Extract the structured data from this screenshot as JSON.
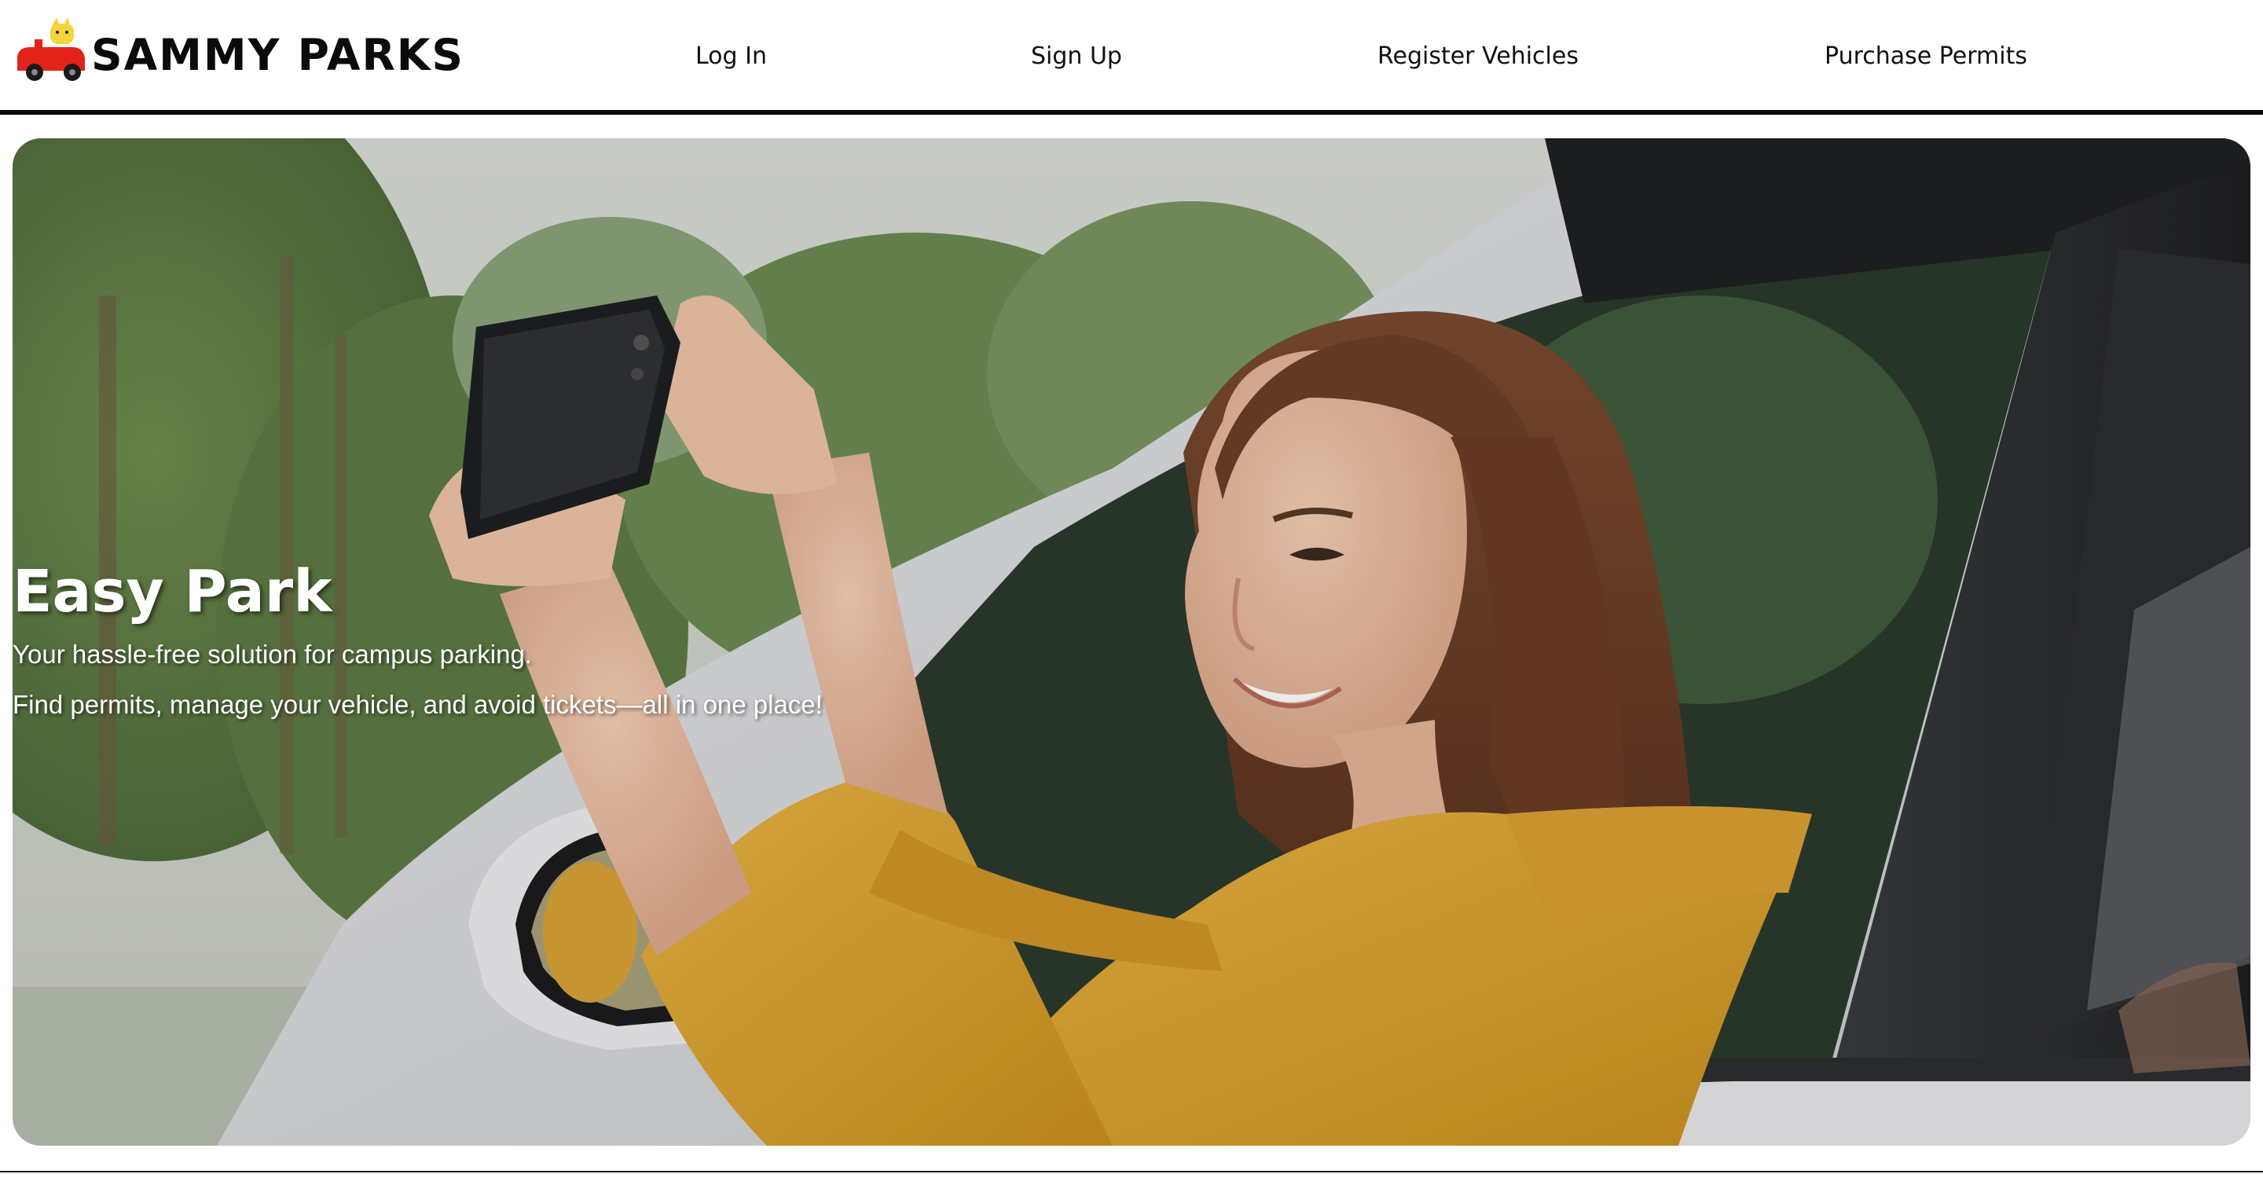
{
  "brand": {
    "name": "SAMMY PARKS",
    "logo_icon": "red-car-with-cat-icon"
  },
  "nav": [
    {
      "label": "Log In"
    },
    {
      "label": "Sign Up"
    },
    {
      "label": "Register Vehicles"
    },
    {
      "label": "Purchase Permits"
    }
  ],
  "hero": {
    "title": "Easy Park",
    "line1": "Your hassle-free solution for campus parking.",
    "line2": "Find permits, manage your vehicle, and avoid tickets—all in one place!",
    "image": "woman-in-yellow-sweater-photographing-from-car-window"
  },
  "colors": {
    "header_border": "#0a0a0a",
    "sweater": "#e0a93a",
    "car_body": "#d9dbde",
    "foliage": "#5f7d45"
  }
}
